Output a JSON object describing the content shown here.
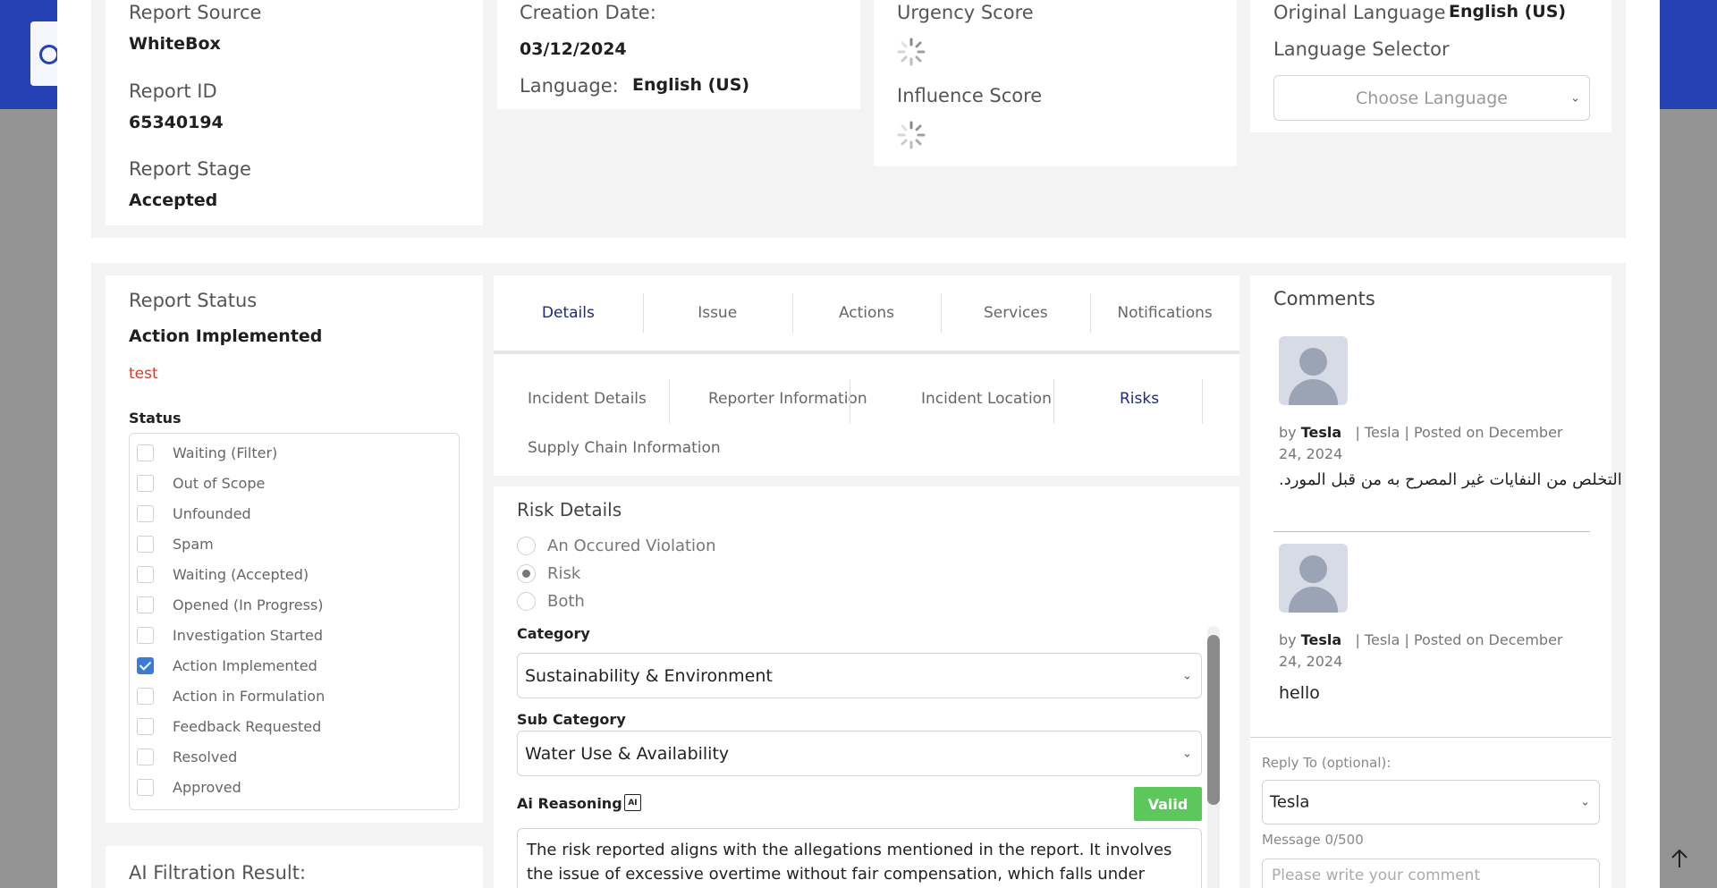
{
  "report_info": {
    "source_label": "Report Source",
    "source_value": "WhiteBox",
    "id_label": "Report ID",
    "id_value": "65340194",
    "stage_label": "Report Stage",
    "stage_value": "Accepted"
  },
  "dates": {
    "creation_label": "Creation Date:",
    "creation_value": "03/12/2024",
    "language_label": "Language:",
    "language_value": "English (US)"
  },
  "scores": {
    "urgency_label": "Urgency Score",
    "influence_label": "Influence Score"
  },
  "language": {
    "original_label": "Original Language",
    "original_value": "English (US)",
    "selector_label": "Language Selector",
    "selector_placeholder": "Choose Language"
  },
  "report_status": {
    "title": "Report Status",
    "value": "Action Implemented",
    "note": "test",
    "status_label": "Status",
    "options": [
      {
        "label": "Waiting (Filter)",
        "checked": false
      },
      {
        "label": "Out of Scope",
        "checked": false
      },
      {
        "label": "Unfounded",
        "checked": false
      },
      {
        "label": "Spam",
        "checked": false
      },
      {
        "label": "Waiting (Accepted)",
        "checked": false
      },
      {
        "label": "Opened (In Progress)",
        "checked": false
      },
      {
        "label": "Investigation Started",
        "checked": false
      },
      {
        "label": "Action Implemented",
        "checked": true
      },
      {
        "label": "Action in Formulation",
        "checked": false
      },
      {
        "label": "Feedback Requested",
        "checked": false
      },
      {
        "label": "Resolved",
        "checked": false
      },
      {
        "label": "Approved",
        "checked": false
      }
    ]
  },
  "ai_filtration": {
    "title": "AI Filtration Result:"
  },
  "main_tabs": [
    {
      "label": "Details",
      "active": true
    },
    {
      "label": "Issue",
      "active": false
    },
    {
      "label": "Actions",
      "active": false
    },
    {
      "label": "Services",
      "active": false
    },
    {
      "label": "Notifications",
      "active": false
    }
  ],
  "sub_tabs": [
    {
      "label": "Incident Details",
      "active": false
    },
    {
      "label": "Reporter Information",
      "active": false
    },
    {
      "label": "Incident Location",
      "active": false
    },
    {
      "label": "Risks",
      "active": true
    },
    {
      "label": "Supply Chain Information",
      "active": false
    }
  ],
  "risk_details": {
    "title": "Risk Details",
    "radio_options": [
      {
        "label": "An Occured Violation",
        "checked": false
      },
      {
        "label": "Risk",
        "checked": true
      },
      {
        "label": "Both",
        "checked": false
      }
    ],
    "category_label": "Category",
    "category_value": "Sustainability & Environment",
    "subcategory_label": "Sub Category",
    "subcategory_value": "Water Use & Availability",
    "ai_reasoning_label": "Ai Reasoning",
    "ai_icon_text": "AI",
    "valid_badge": "Valid",
    "ai_reasoning_text_line1": "The risk reported aligns with the allegations mentioned in the report. It involves",
    "ai_reasoning_text_line2": "the issue of excessive overtime without fair compensation, which falls under"
  },
  "comments": {
    "title": "Comments",
    "items": [
      {
        "by": "by",
        "author": "Tesla",
        "meta": "| Tesla | Posted on December 24, 2024",
        "text": "التخلص من النفايات غير المصرح به من قبل المورد."
      },
      {
        "by": "by",
        "author": "Tesla",
        "meta": "| Tesla | Posted on December 24, 2024",
        "text": "hello"
      }
    ],
    "reply_label": "Reply To (optional):",
    "reply_value": "Tesla",
    "message_label": "Message 0/500",
    "message_placeholder": "Please write your comment"
  },
  "colors": {
    "header_blue": "#2541b2",
    "active_tab": "#1e2a78",
    "valid_green": "#5cc85c",
    "note_red": "#d63b2f",
    "checkbox_blue": "#3a7bd5"
  },
  "icons": [
    "logo-icon",
    "spinner-icon",
    "chevron-down-icon",
    "ai-chip-icon",
    "avatar-icon",
    "arrow-up-icon"
  ]
}
